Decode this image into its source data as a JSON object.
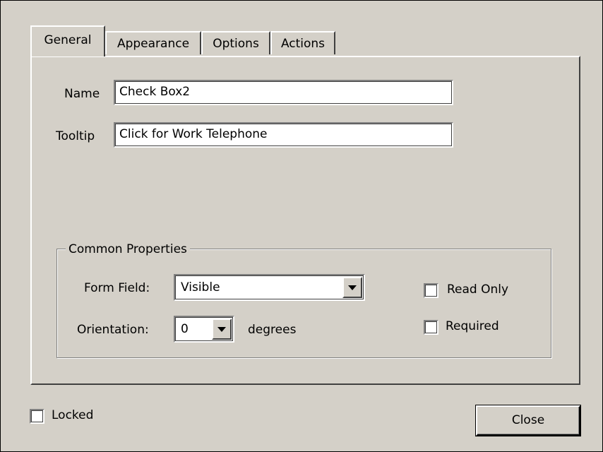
{
  "tabs": [
    {
      "label": "General",
      "active": true
    },
    {
      "label": "Appearance",
      "active": false
    },
    {
      "label": "Options",
      "active": false
    },
    {
      "label": "Actions",
      "active": false
    }
  ],
  "general": {
    "name_label": "Name",
    "name_value": "Check Box2",
    "tooltip_label": "Tooltip",
    "tooltip_value": "Click for Work Telephone"
  },
  "common_properties": {
    "title": "Common Properties",
    "form_field_label": "Form Field:",
    "form_field_value": "Visible",
    "orientation_label": "Orientation:",
    "orientation_value": "0",
    "orientation_unit": "degrees",
    "read_only_label": "Read Only",
    "read_only_checked": false,
    "required_label": "Required",
    "required_checked": false
  },
  "footer": {
    "locked_label": "Locked",
    "locked_checked": false,
    "close_label": "Close"
  },
  "colors": {
    "face": "#d4d0c8",
    "highlight": "#ffffff",
    "shadow": "#808080",
    "dark_shadow": "#404040"
  }
}
